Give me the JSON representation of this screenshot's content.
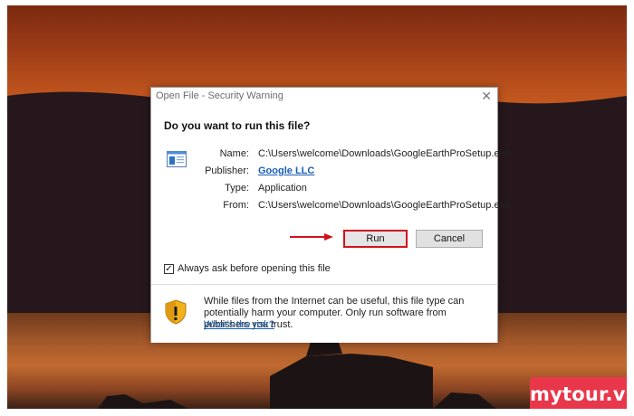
{
  "dialog": {
    "title": "Open File - Security Warning",
    "close_glyph": "✕",
    "question": "Do you want to run this file?",
    "file_icon": "application-window-icon",
    "fields": {
      "name_label": "Name:",
      "name_value": "C:\\Users\\welcome\\Downloads\\GoogleEarthProSetup.exe",
      "publisher_label": "Publisher:",
      "publisher_value": "Google LLC",
      "type_label": "Type:",
      "type_value": "Application",
      "from_label": "From:",
      "from_value": "C:\\Users\\welcome\\Downloads\\GoogleEarthProSetup.exe"
    },
    "run_label": "Run",
    "cancel_label": "Cancel",
    "checkbox_label": "Always ask before opening this file",
    "checkbox_checked": true,
    "check_glyph": "✓",
    "warning_text": "While files from the Internet can be useful, this file type can potentially harm your computer. Only run software from publishers you trust.",
    "risk_link": "What's the risk?"
  },
  "annotation": {
    "highlight_color": "#d0121e"
  },
  "watermark": {
    "text": "mytour.vn",
    "color": "#e8374a"
  }
}
